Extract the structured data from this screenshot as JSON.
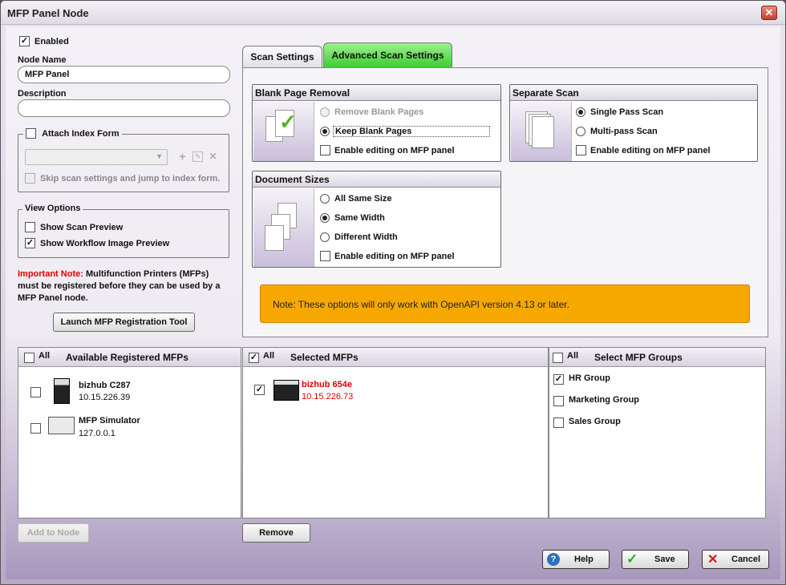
{
  "window": {
    "title": "MFP Panel Node",
    "close_glyph": "✕"
  },
  "left": {
    "enabled_label": "Enabled",
    "enabled_checked": true,
    "node_name_label": "Node Name",
    "node_name_value": "MFP Panel",
    "description_label": "Description",
    "description_value": "",
    "attach_index_label": "Attach Index Form",
    "skip_scan_label": "Skip scan settings and jump to index form.",
    "view_options_label": "View Options",
    "show_scan_preview_label": "Show Scan Preview",
    "show_workflow_preview_label": "Show Workflow Image Preview",
    "important_prefix": "Important Note:",
    "important_text": "Multifunction Printers (MFPs) must be registered before they can be used by a MFP Panel node.",
    "launch_tool_label": "Launch MFP Registration Tool"
  },
  "tabs": [
    {
      "label": "Scan Settings",
      "active": false
    },
    {
      "label": "Advanced Scan Settings",
      "active": true
    }
  ],
  "blank_page": {
    "title": "Blank Page Removal",
    "options": [
      "Remove Blank Pages",
      "Keep Blank Pages"
    ],
    "selected": "Keep Blank Pages",
    "edit_label": "Enable editing on MFP panel"
  },
  "separate_scan": {
    "title": "Separate Scan",
    "options": [
      "Single Pass Scan",
      "Multi-pass Scan"
    ],
    "selected": "Single Pass Scan",
    "edit_label": "Enable editing on MFP panel"
  },
  "document_sizes": {
    "title": "Document Sizes",
    "options": [
      "All Same Size",
      "Same Width",
      "Different Width"
    ],
    "selected": "Same Width",
    "edit_label": "Enable editing on MFP panel"
  },
  "note": "Note: These options will only work with OpenAPI version 4.13 or later.",
  "available": {
    "all_label": "All",
    "title": "Available Registered MFPs",
    "items": [
      {
        "name": "bizhub C287",
        "ip": "10.15.226.39"
      },
      {
        "name": "MFP Simulator",
        "ip": "127.0.0.1"
      }
    ],
    "add_button": "Add to Node"
  },
  "selected": {
    "all_label": "All",
    "title": "Selected MFPs",
    "items": [
      {
        "name": "bizhub 654e",
        "ip": "10.15.226.73"
      }
    ],
    "remove_button": "Remove"
  },
  "groups": {
    "all_label": "All",
    "title": "Select MFP Groups",
    "items": [
      {
        "label": "HR Group",
        "checked": true
      },
      {
        "label": "Marketing Group",
        "checked": false
      },
      {
        "label": "Sales Group",
        "checked": false
      }
    ]
  },
  "footer": {
    "help": "Help",
    "save": "Save",
    "cancel": "Cancel"
  },
  "colors": {
    "accent_green": "#3acb2d",
    "note_orange": "#f7a800",
    "important_red": "#e00000"
  }
}
